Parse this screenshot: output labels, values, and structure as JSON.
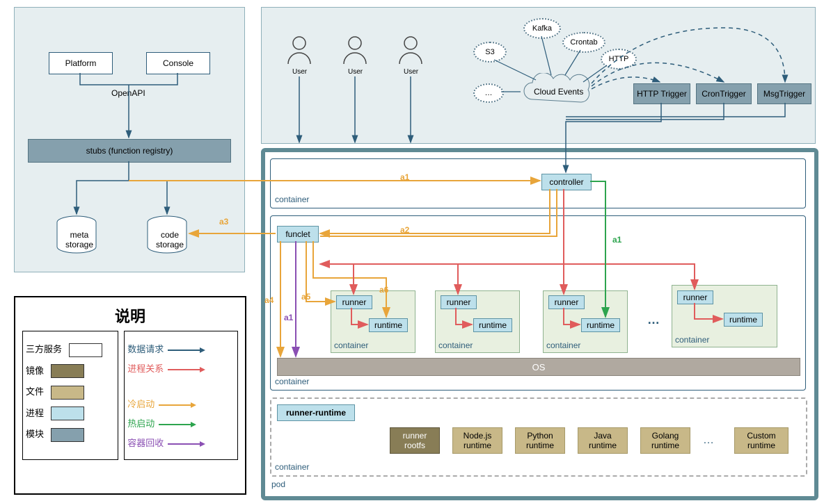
{
  "top_left": {
    "platform": "Platform",
    "console": "Console",
    "openapi": "OpenAPI",
    "stubs": "stubs (function registry)",
    "meta_storage": "meta\nstorage",
    "code_storage": "code\nstorage"
  },
  "top_right": {
    "user": "User",
    "s3": "S3",
    "kafka": "Kafka",
    "crontab": "Crontab",
    "http": "HTTP",
    "dots": "…",
    "cloud_events": "Cloud Events",
    "http_trigger": "HTTP Trigger",
    "cron_trigger": "CronTrigger",
    "msg_trigger": "MsgTrigger"
  },
  "pod": {
    "controller": "controller",
    "funclet": "funclet",
    "runner": "runner",
    "runtime": "runtime",
    "container": "container",
    "os": "OS",
    "pod": "pod",
    "runner_runtime": "runner-runtime",
    "runtimes": [
      "runner\nrootfs",
      "Node.js\nruntime",
      "Python\nruntime",
      "Java\nruntime",
      "Golang\nruntime",
      "…",
      "Custom\nruntime"
    ],
    "ellipsis": "…"
  },
  "edges": {
    "a1": "a1",
    "a2": "a2",
    "a3": "a3",
    "a4": "a4",
    "a5": "a5",
    "a6": "a6"
  },
  "legend": {
    "title": "说明",
    "left": {
      "third_party": "三方服务",
      "image": "镜像",
      "file": "文件",
      "process": "进程",
      "module": "模块"
    },
    "right": {
      "data_req": "数据请求",
      "proc_rel": "进程关系",
      "cold": "冷启动",
      "hot": "热启动",
      "recycle": "容器回收"
    }
  },
  "chart_data": {
    "type": "diagram",
    "title": "Serverless / FaaS architecture",
    "nodes": [
      {
        "id": "platform",
        "label": "Platform",
        "kind": "third_party"
      },
      {
        "id": "console",
        "label": "Console",
        "kind": "third_party"
      },
      {
        "id": "openapi",
        "label": "OpenAPI",
        "kind": "text"
      },
      {
        "id": "stubs",
        "label": "stubs (function registry)",
        "kind": "module"
      },
      {
        "id": "meta",
        "label": "meta storage",
        "kind": "storage"
      },
      {
        "id": "code",
        "label": "code storage",
        "kind": "storage"
      },
      {
        "id": "user1",
        "label": "User",
        "kind": "actor"
      },
      {
        "id": "user2",
        "label": "User",
        "kind": "actor"
      },
      {
        "id": "user3",
        "label": "User",
        "kind": "actor"
      },
      {
        "id": "s3",
        "label": "S3",
        "kind": "event_source"
      },
      {
        "id": "kafka",
        "label": "Kafka",
        "kind": "event_source"
      },
      {
        "id": "crontab",
        "label": "Crontab",
        "kind": "event_source"
      },
      {
        "id": "http",
        "label": "HTTP",
        "kind": "event_source"
      },
      {
        "id": "events_more",
        "label": "…",
        "kind": "event_source"
      },
      {
        "id": "cloud_events",
        "label": "Cloud Events",
        "kind": "cloud"
      },
      {
        "id": "http_trigger",
        "label": "HTTP Trigger",
        "kind": "module"
      },
      {
        "id": "cron_trigger",
        "label": "CronTrigger",
        "kind": "module"
      },
      {
        "id": "msg_trigger",
        "label": "MsgTrigger",
        "kind": "module"
      },
      {
        "id": "controller",
        "label": "controller",
        "kind": "process"
      },
      {
        "id": "funclet",
        "label": "funclet",
        "kind": "process"
      },
      {
        "id": "runner1",
        "label": "runner",
        "kind": "process"
      },
      {
        "id": "runtime1",
        "label": "runtime",
        "kind": "process"
      },
      {
        "id": "runner2",
        "label": "runner",
        "kind": "process"
      },
      {
        "id": "runtime2",
        "label": "runtime",
        "kind": "process"
      },
      {
        "id": "runner3",
        "label": "runner",
        "kind": "process"
      },
      {
        "id": "runtime3",
        "label": "runtime",
        "kind": "process"
      },
      {
        "id": "runner4",
        "label": "runner",
        "kind": "process"
      },
      {
        "id": "runtime4",
        "label": "runtime",
        "kind": "process"
      },
      {
        "id": "os",
        "label": "OS",
        "kind": "image"
      },
      {
        "id": "runner_runtime",
        "label": "runner-runtime",
        "kind": "process"
      },
      {
        "id": "rootfs",
        "label": "runner rootfs",
        "kind": "image"
      },
      {
        "id": "node",
        "label": "Node.js runtime",
        "kind": "file"
      },
      {
        "id": "python",
        "label": "Python runtime",
        "kind": "file"
      },
      {
        "id": "java",
        "label": "Java runtime",
        "kind": "file"
      },
      {
        "id": "golang",
        "label": "Golang runtime",
        "kind": "file"
      },
      {
        "id": "rt_more",
        "label": "…",
        "kind": "text"
      },
      {
        "id": "custom",
        "label": "Custom runtime",
        "kind": "file"
      }
    ],
    "edges": [
      {
        "from": "platform",
        "to": "openapi",
        "kind": "data_request"
      },
      {
        "from": "console",
        "to": "openapi",
        "kind": "data_request"
      },
      {
        "from": "openapi",
        "to": "stubs",
        "kind": "data_request"
      },
      {
        "from": "stubs",
        "to": "meta",
        "kind": "data_request"
      },
      {
        "from": "stubs",
        "to": "code",
        "kind": "data_request"
      },
      {
        "from": "user1",
        "to": "http_trigger",
        "kind": "data_request"
      },
      {
        "from": "user2",
        "to": "http_trigger",
        "kind": "data_request"
      },
      {
        "from": "user3",
        "to": "http_trigger",
        "kind": "data_request"
      },
      {
        "from": "s3",
        "to": "cloud_events",
        "kind": "data_request"
      },
      {
        "from": "kafka",
        "to": "cloud_events",
        "kind": "data_request"
      },
      {
        "from": "crontab",
        "to": "cloud_events",
        "kind": "data_request"
      },
      {
        "from": "http",
        "to": "cloud_events",
        "kind": "data_request"
      },
      {
        "from": "events_more",
        "to": "cloud_events",
        "kind": "data_request"
      },
      {
        "from": "cloud_events",
        "to": "msg_trigger",
        "kind": "data_request",
        "style": "dashed"
      },
      {
        "from": "cloud_events",
        "to": "cron_trigger",
        "kind": "data_request",
        "style": "dashed"
      },
      {
        "from": "cloud_events",
        "to": "http_trigger",
        "kind": "data_request",
        "style": "dashed"
      },
      {
        "from": "http_trigger",
        "to": "controller",
        "kind": "data_request"
      },
      {
        "from": "cron_trigger",
        "to": "controller",
        "kind": "data_request"
      },
      {
        "from": "msg_trigger",
        "to": "controller",
        "kind": "data_request"
      },
      {
        "from": "stubs",
        "to": "controller",
        "kind": "cold_start",
        "label": "a1"
      },
      {
        "from": "controller",
        "to": "funclet",
        "kind": "cold_start",
        "label": "a2"
      },
      {
        "from": "funclet",
        "to": "code",
        "kind": "cold_start",
        "label": "a3"
      },
      {
        "from": "funclet",
        "to": "os",
        "kind": "cold_start",
        "label": "a4"
      },
      {
        "from": "funclet",
        "to": "runner1",
        "kind": "cold_start",
        "label": "a5"
      },
      {
        "from": "funclet",
        "to": "runtime1",
        "kind": "cold_start",
        "label": "a6"
      },
      {
        "from": "controller",
        "to": "runtime3",
        "kind": "hot_start",
        "label": "a1"
      },
      {
        "from": "funclet",
        "to": "os",
        "kind": "container_recycle",
        "label": "a1"
      },
      {
        "from": "controller",
        "to": "runner1",
        "kind": "process_relation"
      },
      {
        "from": "controller",
        "to": "runner2",
        "kind": "process_relation"
      },
      {
        "from": "controller",
        "to": "runner3",
        "kind": "process_relation"
      },
      {
        "from": "controller",
        "to": "runner4",
        "kind": "process_relation"
      },
      {
        "from": "controller",
        "to": "funclet",
        "kind": "process_relation"
      },
      {
        "from": "runner1",
        "to": "runtime1",
        "kind": "process_relation"
      },
      {
        "from": "runner2",
        "to": "runtime2",
        "kind": "process_relation"
      },
      {
        "from": "runner3",
        "to": "runtime3",
        "kind": "process_relation"
      },
      {
        "from": "runner4",
        "to": "runtime4",
        "kind": "process_relation"
      }
    ],
    "containers": [
      {
        "id": "top_left_region",
        "children": [
          "platform",
          "console",
          "openapi",
          "stubs",
          "meta",
          "code"
        ]
      },
      {
        "id": "top_right_region",
        "children": [
          "user1",
          "user2",
          "user3",
          "s3",
          "kafka",
          "crontab",
          "http",
          "events_more",
          "cloud_events",
          "http_trigger",
          "cron_trigger",
          "msg_trigger"
        ]
      },
      {
        "id": "pod",
        "label": "pod",
        "children": [
          "controller_container",
          "funclet_container",
          "runtime_container"
        ]
      },
      {
        "id": "controller_container",
        "label": "container",
        "children": [
          "controller"
        ]
      },
      {
        "id": "funclet_container",
        "label": "container",
        "children": [
          "funclet",
          "runner_container1",
          "runner_container2",
          "runner_container3",
          "runner_container4",
          "os"
        ]
      },
      {
        "id": "runner_container1",
        "label": "container",
        "children": [
          "runner1",
          "runtime1"
        ]
      },
      {
        "id": "runner_container2",
        "label": "container",
        "children": [
          "runner2",
          "runtime2"
        ]
      },
      {
        "id": "runner_container3",
        "label": "container",
        "children": [
          "runner3",
          "runtime3"
        ]
      },
      {
        "id": "runner_container4",
        "label": "container",
        "children": [
          "runner4",
          "runtime4"
        ]
      },
      {
        "id": "runtime_container",
        "label": "container",
        "children": [
          "runner_runtime",
          "rootfs",
          "node",
          "python",
          "java",
          "golang",
          "rt_more",
          "custom"
        ]
      }
    ],
    "legend": {
      "node_kinds": {
        "third_party": "三方服务",
        "image": "镜像",
        "file": "文件",
        "process": "进程",
        "module": "模块"
      },
      "edge_kinds": {
        "data_request": "数据请求",
        "process_relation": "进程关系",
        "cold_start": "冷启动",
        "hot_start": "热启动",
        "container_recycle": "容器回收"
      }
    }
  }
}
